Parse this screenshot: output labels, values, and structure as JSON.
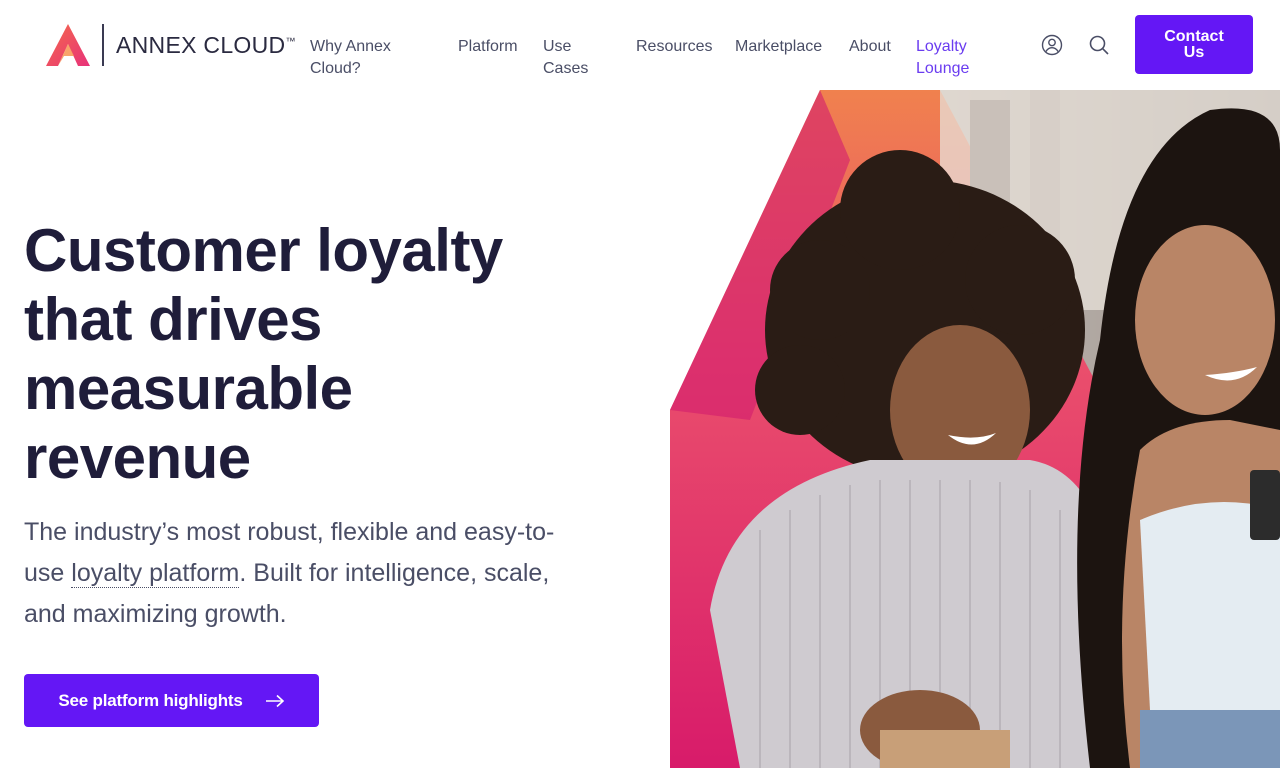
{
  "brand": {
    "name": "ANNEX CLOUD",
    "trademark": "™",
    "logo_colors": [
      "#f46a4a",
      "#e8327a",
      "#f79a5a"
    ]
  },
  "nav": {
    "items": [
      {
        "label_line1": "Why Annex",
        "label_line2": "Cloud?",
        "accent": false
      },
      {
        "label_line1": "Platform",
        "label_line2": "",
        "accent": false
      },
      {
        "label_line1": "Use",
        "label_line2": "Cases",
        "accent": false
      },
      {
        "label_line1": "Resources",
        "label_line2": "",
        "accent": false
      },
      {
        "label_line1": "Marketplace",
        "label_line2": "",
        "accent": false
      },
      {
        "label_line1": "About",
        "label_line2": "",
        "accent": false
      },
      {
        "label_line1": "Loyalty",
        "label_line2": "Lounge",
        "accent": true
      }
    ],
    "icons": [
      "user-icon",
      "search-icon"
    ],
    "contact_line1": "Contact",
    "contact_line2": "Us"
  },
  "hero": {
    "title_lines": [
      "Customer loyalty",
      "that drives",
      "measurable",
      "revenue"
    ],
    "subtitle_before": "The industry’s most robust, flexible and easy-to-use ",
    "subtitle_link": "loyalty platform",
    "subtitle_after": ". Built for intelligence, scale, and maximizing growth.",
    "cta_label": "See platform highlights",
    "cta_icon": "arrow-right-icon"
  },
  "colors": {
    "primary": "#6417f5",
    "accent_link": "#6a3cf0",
    "heading": "#1f1d3a",
    "body": "#4a4e66"
  }
}
